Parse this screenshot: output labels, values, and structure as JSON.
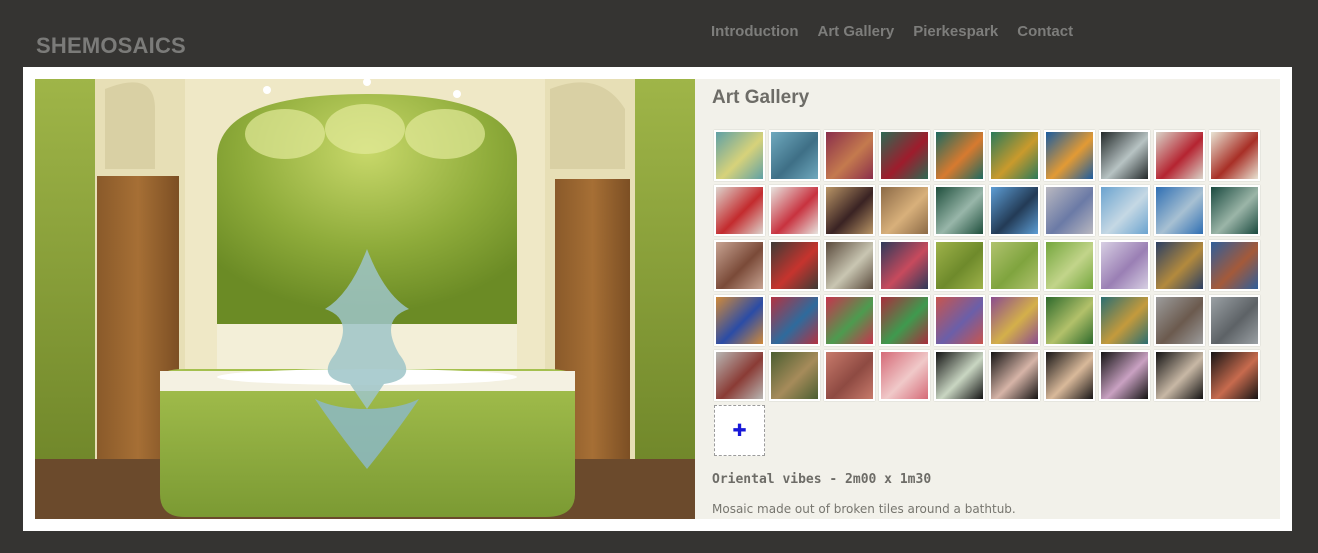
{
  "site": {
    "title": "SHEMOSAICS"
  },
  "nav": [
    {
      "label": "Introduction"
    },
    {
      "label": "Art Gallery"
    },
    {
      "label": "Pierkespark"
    },
    {
      "label": "Contact"
    }
  ],
  "gallery": {
    "title": "Art Gallery",
    "more_icon": "plus-icon",
    "thumbnails": [
      {
        "colors": [
          "#5fa0a5",
          "#d7d27a"
        ]
      },
      {
        "colors": [
          "#6fa9be",
          "#3e6f86"
        ]
      },
      {
        "colors": [
          "#8a2e4b",
          "#c47a4e"
        ]
      },
      {
        "colors": [
          "#2d6a54",
          "#9e1c2c"
        ]
      },
      {
        "colors": [
          "#1d6a60",
          "#d77a2f"
        ]
      },
      {
        "colors": [
          "#2a7a5a",
          "#c99a2c"
        ]
      },
      {
        "colors": [
          "#1b5c9f",
          "#e29a34"
        ]
      },
      {
        "colors": [
          "#23292a",
          "#b7c3c3"
        ]
      },
      {
        "colors": [
          "#d9d3c8",
          "#b52431"
        ]
      },
      {
        "colors": [
          "#e8e3d3",
          "#a82f26"
        ]
      },
      {
        "colors": [
          "#ddd3cc",
          "#c32b2e"
        ]
      },
      {
        "colors": [
          "#e7e3de",
          "#c8323f"
        ]
      },
      {
        "colors": [
          "#b99566",
          "#3a2323"
        ]
      },
      {
        "colors": [
          "#8c6a46",
          "#d8b07b"
        ]
      },
      {
        "colors": [
          "#1f4f3d",
          "#98b6a9"
        ]
      },
      {
        "colors": [
          "#5d9dd4",
          "#233b56"
        ]
      },
      {
        "colors": [
          "#b9b8c0",
          "#6b7aa6"
        ]
      },
      {
        "colors": [
          "#6ba3cf",
          "#c5d8e4"
        ]
      },
      {
        "colors": [
          "#2f6fb3",
          "#a7c0d2"
        ]
      },
      {
        "colors": [
          "#1a4a3f",
          "#9bb5a8"
        ]
      },
      {
        "colors": [
          "#c7a392",
          "#7a4a38"
        ]
      },
      {
        "colors": [
          "#3e3b36",
          "#c6342e"
        ]
      },
      {
        "colors": [
          "#5a4a3c",
          "#c9c6b2"
        ]
      },
      {
        "colors": [
          "#2e3a5a",
          "#c74a5d"
        ]
      },
      {
        "colors": [
          "#9eb24a",
          "#6e8a2b"
        ]
      },
      {
        "colors": [
          "#b0c26e",
          "#7fa43e"
        ]
      },
      {
        "colors": [
          "#74a63d",
          "#c2d48a"
        ]
      },
      {
        "colors": [
          "#d7cfe3",
          "#9a7fb4"
        ]
      },
      {
        "colors": [
          "#2b3f63",
          "#b38a3d"
        ]
      },
      {
        "colors": [
          "#2f5e9a",
          "#a45a3a"
        ]
      },
      {
        "colors": [
          "#d08a3a",
          "#2b4ca6"
        ]
      },
      {
        "colors": [
          "#b33241",
          "#2e6b9d"
        ]
      },
      {
        "colors": [
          "#c7344d",
          "#4d9b4f"
        ]
      },
      {
        "colors": [
          "#a82e3d",
          "#3f9a4e"
        ]
      },
      {
        "colors": [
          "#c8554e",
          "#6b5fa9"
        ]
      },
      {
        "colors": [
          "#8b4c8e",
          "#d4b04a"
        ]
      },
      {
        "colors": [
          "#2e6a2c",
          "#b2c16a"
        ]
      },
      {
        "colors": [
          "#2b6e71",
          "#c49a3c"
        ]
      },
      {
        "colors": [
          "#9c9c9c",
          "#6b5a4e"
        ]
      },
      {
        "colors": [
          "#9aa0a4",
          "#5d6266"
        ]
      },
      {
        "colors": [
          "#b8b6b3",
          "#8a3b35"
        ]
      },
      {
        "colors": [
          "#4b5e31",
          "#a68b5a"
        ]
      },
      {
        "colors": [
          "#c77a6b",
          "#8e4a42"
        ]
      },
      {
        "colors": [
          "#d56a77",
          "#f0c9c9"
        ]
      },
      {
        "colors": [
          "#141414",
          "#c9d6c2"
        ]
      },
      {
        "colors": [
          "#161414",
          "#d6b4a7"
        ]
      },
      {
        "colors": [
          "#181616",
          "#d9b99a"
        ]
      },
      {
        "colors": [
          "#151414",
          "#c9a1c2"
        ]
      },
      {
        "colors": [
          "#141313",
          "#c8b8a5"
        ]
      },
      {
        "colors": [
          "#171515",
          "#c76b4e"
        ]
      }
    ]
  },
  "artwork": {
    "title": "Oriental vibes - 2m00 x 1m30",
    "description": "Mosaic made out of broken tiles around a bathtub."
  }
}
